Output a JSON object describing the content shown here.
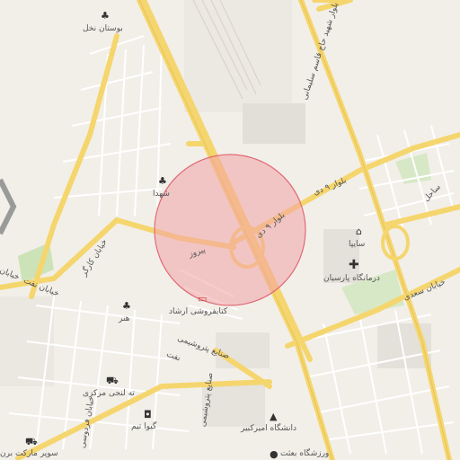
{
  "map": {
    "colors": {
      "background": "#f2efe9",
      "major_road": "#f5d66e",
      "minor_road": "#ffffff",
      "park": "#cce3b8",
      "highlight_fill": "#f3a3a8",
      "highlight_stroke": "#e06b74"
    },
    "labels": {
      "park_north": "بوستان نخل",
      "shohada": "شهدا",
      "piruz": "پیروز",
      "khayaban_kargar": "خیابان کارگر",
      "khayaban_naft": "خیابان نفت",
      "honar": "هنر",
      "bookstore": "کتابفروشی ارشاد",
      "industry_st": "صنایع پتروشیمی",
      "naft2": "نفت",
      "talangi": "ته لنجی مرکزی",
      "giva": "گیوا تیم",
      "supermarket": "سوپر مارکت برن",
      "farsi_st": "خیابان فردوسی",
      "blvd_9dey_a": "بلوار ۹ دی",
      "blvd_9dey_b": "بلوار ۹ دی",
      "blvd_soleimani": "بلوار شهید حاج قاسم سلیمانی",
      "saipa": "سایپا",
      "parsian_clinic": "درمانگاه پارسیان",
      "amirkabir": "دانشگاه امیرکبیر",
      "besat": "ورزشگاه بعثت",
      "khayaban_saadi": "خیابان سعدی",
      "khayaban_left_top": "خیابان ...",
      "sahel": "ساحل"
    }
  }
}
